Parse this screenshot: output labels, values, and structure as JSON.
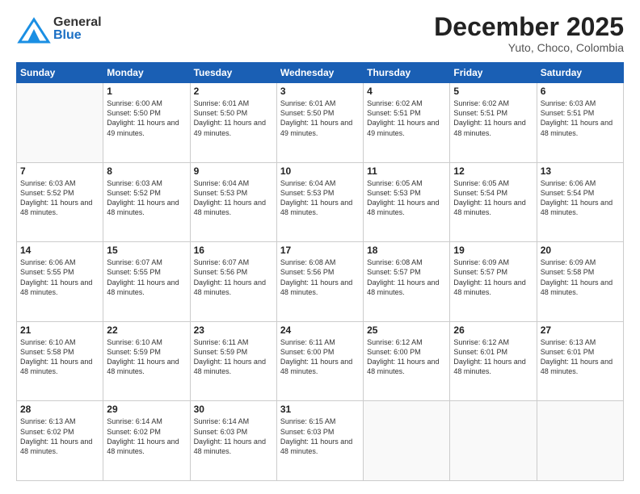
{
  "header": {
    "logo": {
      "line1": "General",
      "line2": "Blue"
    },
    "title": "December 2025",
    "location": "Yuto, Choco, Colombia"
  },
  "calendar": {
    "days_of_week": [
      "Sunday",
      "Monday",
      "Tuesday",
      "Wednesday",
      "Thursday",
      "Friday",
      "Saturday"
    ],
    "weeks": [
      [
        {
          "day": "",
          "info": ""
        },
        {
          "day": "1",
          "info": "Sunrise: 6:00 AM\nSunset: 5:50 PM\nDaylight: 11 hours\nand 49 minutes."
        },
        {
          "day": "2",
          "info": "Sunrise: 6:01 AM\nSunset: 5:50 PM\nDaylight: 11 hours\nand 49 minutes."
        },
        {
          "day": "3",
          "info": "Sunrise: 6:01 AM\nSunset: 5:50 PM\nDaylight: 11 hours\nand 49 minutes."
        },
        {
          "day": "4",
          "info": "Sunrise: 6:02 AM\nSunset: 5:51 PM\nDaylight: 11 hours\nand 49 minutes."
        },
        {
          "day": "5",
          "info": "Sunrise: 6:02 AM\nSunset: 5:51 PM\nDaylight: 11 hours\nand 48 minutes."
        },
        {
          "day": "6",
          "info": "Sunrise: 6:03 AM\nSunset: 5:51 PM\nDaylight: 11 hours\nand 48 minutes."
        }
      ],
      [
        {
          "day": "7",
          "info": "Sunrise: 6:03 AM\nSunset: 5:52 PM\nDaylight: 11 hours\nand 48 minutes."
        },
        {
          "day": "8",
          "info": "Sunrise: 6:03 AM\nSunset: 5:52 PM\nDaylight: 11 hours\nand 48 minutes."
        },
        {
          "day": "9",
          "info": "Sunrise: 6:04 AM\nSunset: 5:53 PM\nDaylight: 11 hours\nand 48 minutes."
        },
        {
          "day": "10",
          "info": "Sunrise: 6:04 AM\nSunset: 5:53 PM\nDaylight: 11 hours\nand 48 minutes."
        },
        {
          "day": "11",
          "info": "Sunrise: 6:05 AM\nSunset: 5:53 PM\nDaylight: 11 hours\nand 48 minutes."
        },
        {
          "day": "12",
          "info": "Sunrise: 6:05 AM\nSunset: 5:54 PM\nDaylight: 11 hours\nand 48 minutes."
        },
        {
          "day": "13",
          "info": "Sunrise: 6:06 AM\nSunset: 5:54 PM\nDaylight: 11 hours\nand 48 minutes."
        }
      ],
      [
        {
          "day": "14",
          "info": "Sunrise: 6:06 AM\nSunset: 5:55 PM\nDaylight: 11 hours\nand 48 minutes."
        },
        {
          "day": "15",
          "info": "Sunrise: 6:07 AM\nSunset: 5:55 PM\nDaylight: 11 hours\nand 48 minutes."
        },
        {
          "day": "16",
          "info": "Sunrise: 6:07 AM\nSunset: 5:56 PM\nDaylight: 11 hours\nand 48 minutes."
        },
        {
          "day": "17",
          "info": "Sunrise: 6:08 AM\nSunset: 5:56 PM\nDaylight: 11 hours\nand 48 minutes."
        },
        {
          "day": "18",
          "info": "Sunrise: 6:08 AM\nSunset: 5:57 PM\nDaylight: 11 hours\nand 48 minutes."
        },
        {
          "day": "19",
          "info": "Sunrise: 6:09 AM\nSunset: 5:57 PM\nDaylight: 11 hours\nand 48 minutes."
        },
        {
          "day": "20",
          "info": "Sunrise: 6:09 AM\nSunset: 5:58 PM\nDaylight: 11 hours\nand 48 minutes."
        }
      ],
      [
        {
          "day": "21",
          "info": "Sunrise: 6:10 AM\nSunset: 5:58 PM\nDaylight: 11 hours\nand 48 minutes."
        },
        {
          "day": "22",
          "info": "Sunrise: 6:10 AM\nSunset: 5:59 PM\nDaylight: 11 hours\nand 48 minutes."
        },
        {
          "day": "23",
          "info": "Sunrise: 6:11 AM\nSunset: 5:59 PM\nDaylight: 11 hours\nand 48 minutes."
        },
        {
          "day": "24",
          "info": "Sunrise: 6:11 AM\nSunset: 6:00 PM\nDaylight: 11 hours\nand 48 minutes."
        },
        {
          "day": "25",
          "info": "Sunrise: 6:12 AM\nSunset: 6:00 PM\nDaylight: 11 hours\nand 48 minutes."
        },
        {
          "day": "26",
          "info": "Sunrise: 6:12 AM\nSunset: 6:01 PM\nDaylight: 11 hours\nand 48 minutes."
        },
        {
          "day": "27",
          "info": "Sunrise: 6:13 AM\nSunset: 6:01 PM\nDaylight: 11 hours\nand 48 minutes."
        }
      ],
      [
        {
          "day": "28",
          "info": "Sunrise: 6:13 AM\nSunset: 6:02 PM\nDaylight: 11 hours\nand 48 minutes."
        },
        {
          "day": "29",
          "info": "Sunrise: 6:14 AM\nSunset: 6:02 PM\nDaylight: 11 hours\nand 48 minutes."
        },
        {
          "day": "30",
          "info": "Sunrise: 6:14 AM\nSunset: 6:03 PM\nDaylight: 11 hours\nand 48 minutes."
        },
        {
          "day": "31",
          "info": "Sunrise: 6:15 AM\nSunset: 6:03 PM\nDaylight: 11 hours\nand 48 minutes."
        },
        {
          "day": "",
          "info": ""
        },
        {
          "day": "",
          "info": ""
        },
        {
          "day": "",
          "info": ""
        }
      ]
    ]
  }
}
